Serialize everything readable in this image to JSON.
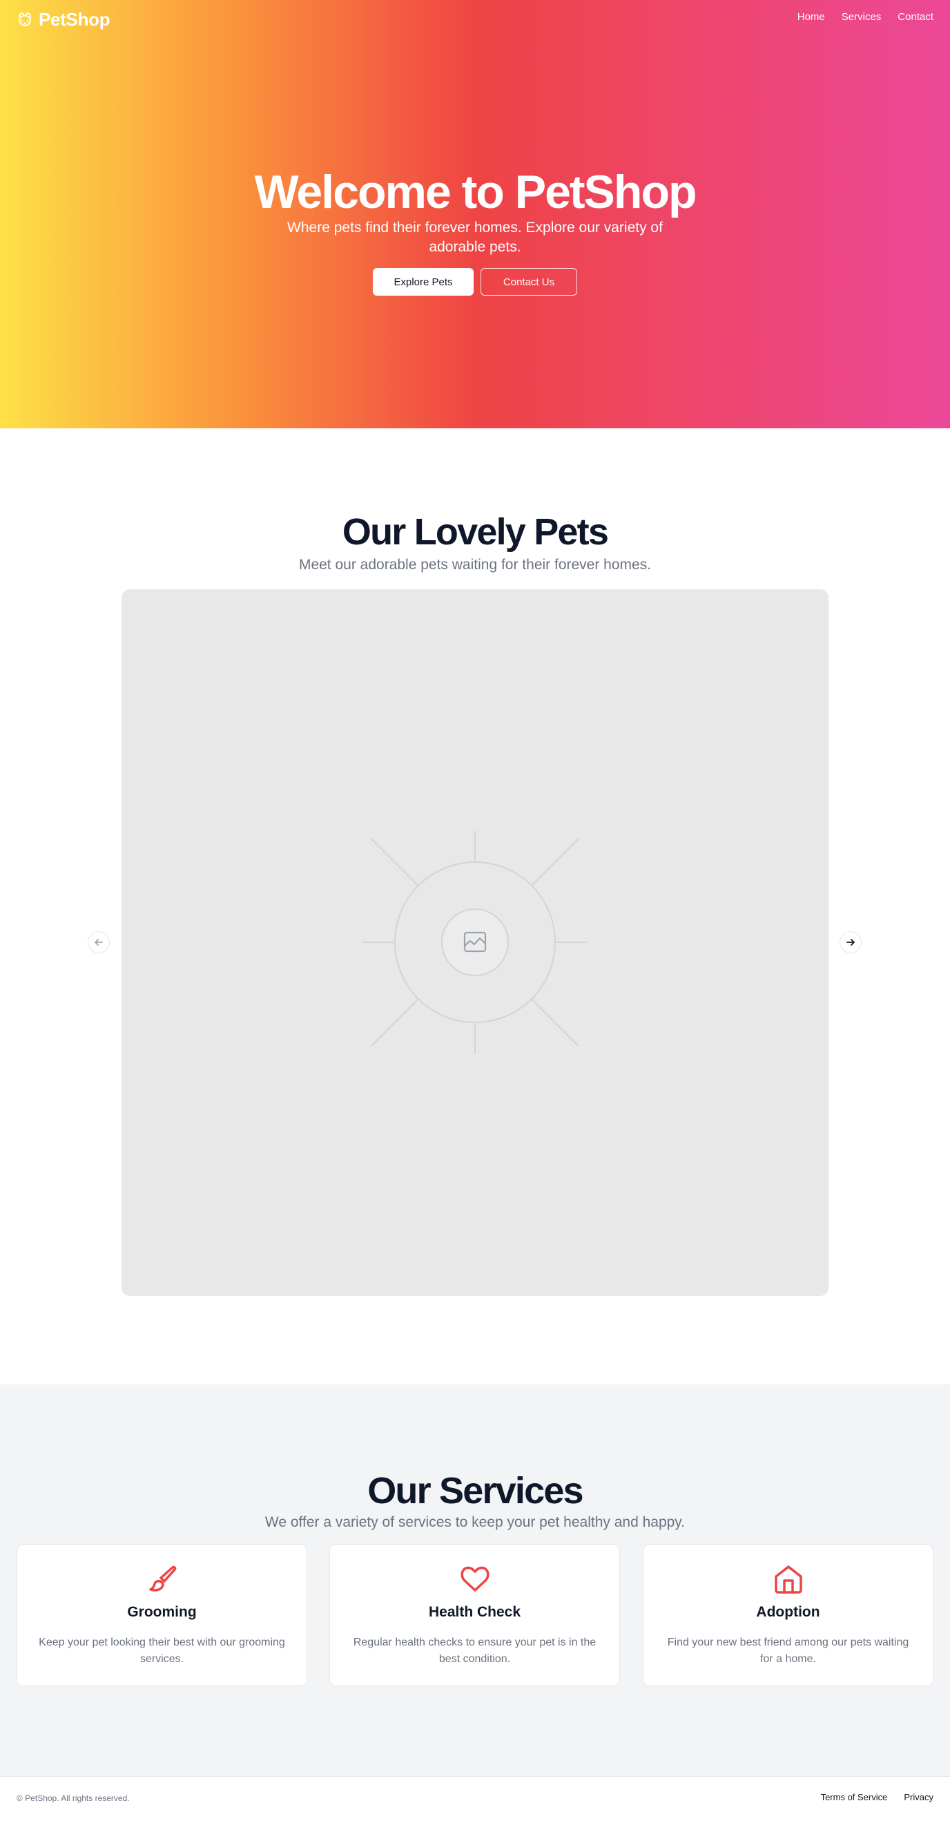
{
  "nav": {
    "brand": "PetShop",
    "logo_icon": "paw-icon",
    "links": [
      "Home",
      "Services",
      "Contact"
    ]
  },
  "hero": {
    "title": "Welcome to PetShop",
    "subtitle": "Where pets find their forever homes. Explore our variety of adorable pets.",
    "primary_button": "Explore Pets",
    "secondary_button": "Contact Us",
    "gradient_colors": [
      "#fde047",
      "#fb923c",
      "#ef4444",
      "#ec4899"
    ]
  },
  "pets": {
    "title": "Our Lovely Pets",
    "subtitle": "Meet our adorable pets waiting for their forever homes.",
    "placeholder_icon": "image-icon",
    "prev_icon": "arrow-left-icon",
    "next_icon": "arrow-right-icon"
  },
  "services": {
    "title": "Our Services",
    "subtitle": "We offer a variety of services to keep your pet healthy and happy.",
    "accent_color": "#ef4444",
    "cards": [
      {
        "icon": "brush-icon",
        "title": "Grooming",
        "description": "Keep your pet looking their best with our grooming services."
      },
      {
        "icon": "heart-icon",
        "title": "Health Check",
        "description": "Regular health checks to ensure your pet is in the best condition."
      },
      {
        "icon": "home-icon",
        "title": "Adoption",
        "description": "Find your new best friend among our pets waiting for a home."
      }
    ]
  },
  "footer": {
    "copyright": "© PetShop. All rights reserved.",
    "links": [
      "Terms of Service",
      "Privacy"
    ]
  }
}
